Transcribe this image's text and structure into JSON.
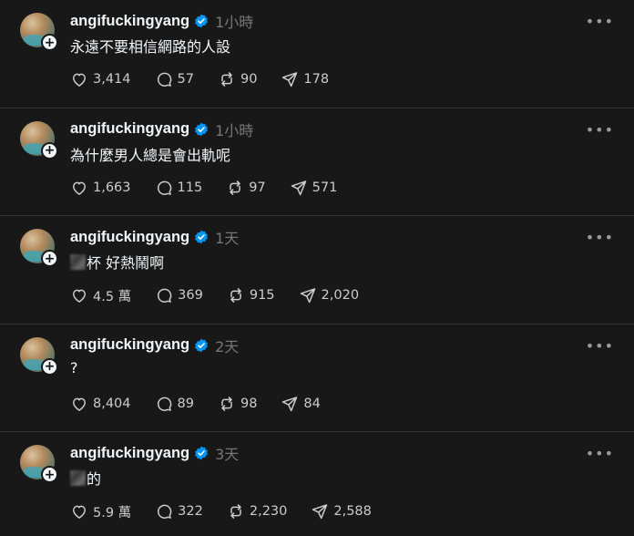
{
  "posts": [
    {
      "username": "angifuckingyang",
      "time": "1小時",
      "text": "永遠不要相信網路的人設",
      "redacted": false,
      "likes": "3,414",
      "replies": "57",
      "reposts": "90",
      "shares": "178"
    },
    {
      "username": "angifuckingyang",
      "time": "1小時",
      "text": "為什麼男人總是會出軌呢",
      "redacted": false,
      "likes": "1,663",
      "replies": "115",
      "reposts": "97",
      "shares": "571"
    },
    {
      "username": "angifuckingyang",
      "time": "1天",
      "text": "杯 好熱鬧啊",
      "redacted": true,
      "likes": "4.5 萬",
      "replies": "369",
      "reposts": "915",
      "shares": "2,020"
    },
    {
      "username": "angifuckingyang",
      "time": "2天",
      "text": "?",
      "redacted": false,
      "likes": "8,404",
      "replies": "89",
      "reposts": "98",
      "shares": "84"
    },
    {
      "username": "angifuckingyang",
      "time": "3天",
      "text": "的",
      "redacted": true,
      "likes": "5.9 萬",
      "replies": "322",
      "reposts": "2,230",
      "shares": "2,588"
    }
  ],
  "icons": {
    "more": "more-horizontal-icon",
    "like": "heart-icon",
    "reply": "comment-icon",
    "repost": "repost-icon",
    "share": "send-icon",
    "verified": "verified-badge-icon",
    "follow": "plus-icon"
  },
  "colors": {
    "background": "#181818",
    "text": "#f3f5f7",
    "muted": "#777777",
    "verified": "#0095f6",
    "divider": "#333638"
  }
}
